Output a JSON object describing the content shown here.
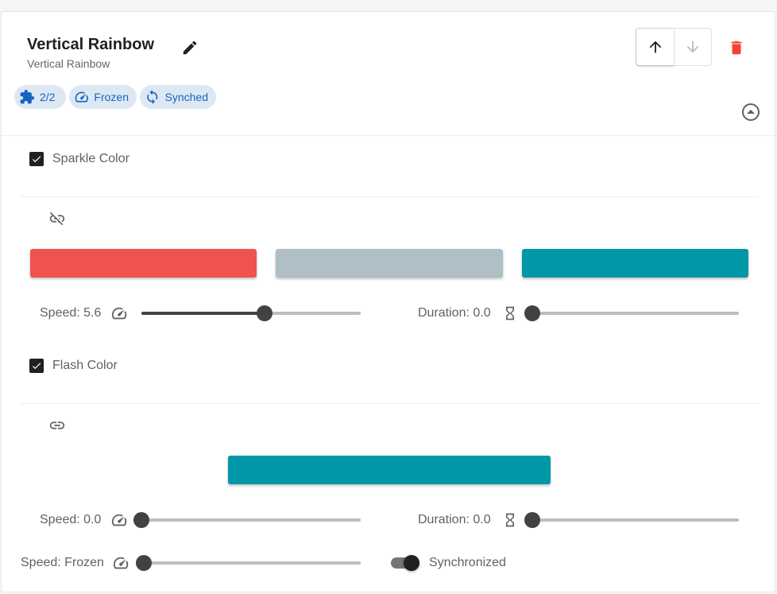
{
  "header": {
    "title": "Vertical Rainbow",
    "subtitle": "Vertical Rainbow",
    "chips": [
      {
        "icon": "puzzle-icon",
        "label": "2/2"
      },
      {
        "icon": "speedometer-icon",
        "label": "Frozen"
      },
      {
        "icon": "sync-icon",
        "label": "Synched"
      }
    ]
  },
  "sections": {
    "sparkle": {
      "checkbox_label": "Sparkle Color",
      "checked": true,
      "link_icon": "link-off-icon",
      "colors": [
        "#ef5350",
        "#b0bec5",
        "#0097a7"
      ],
      "speed_label": "Speed: 5.6",
      "speed_value": 5.6,
      "duration_label": "Duration: 0.0",
      "duration_value": 0.0
    },
    "flash": {
      "checkbox_label": "Flash Color",
      "checked": true,
      "link_icon": "link-icon",
      "colors": [
        "#0097a7"
      ],
      "speed_label": "Speed: 0.0",
      "speed_value": 0.0,
      "duration_label": "Duration: 0.0",
      "duration_value": 0.0
    }
  },
  "footer": {
    "speed_label": "Speed: Frozen",
    "switch_label": "Synchronized",
    "switch_on": true
  },
  "colors": {
    "accent": "#1565c0",
    "chip_bg": "#dde8f3",
    "delete": "#f44336"
  }
}
